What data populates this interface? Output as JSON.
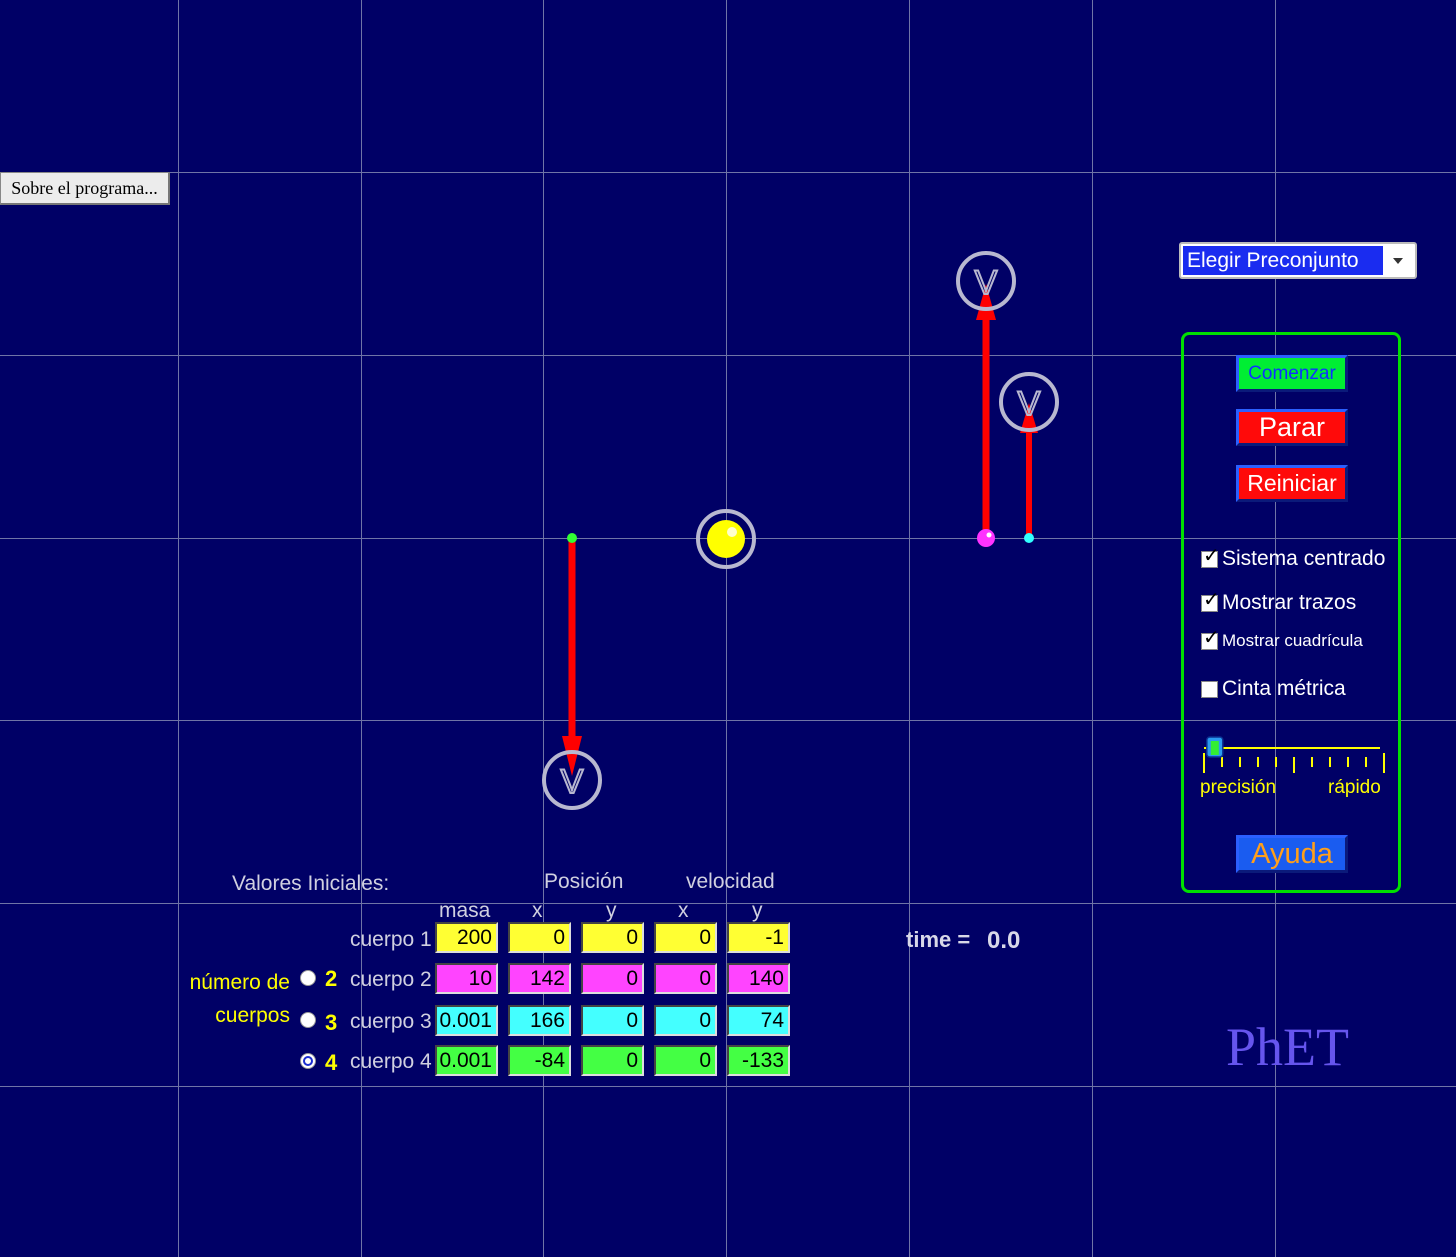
{
  "about_button": {
    "label": "Sobre el programa..."
  },
  "preset": {
    "selected": "Elegir Preconjunto"
  },
  "controls": {
    "start": "Comenzar",
    "stop": "Parar",
    "reset": "Reiniciar",
    "help": "Ayuda",
    "checkboxes": [
      {
        "label": "Sistema centrado",
        "checked": true
      },
      {
        "label": "Mostrar trazos",
        "checked": true
      },
      {
        "label": "Mostrar cuadrícula",
        "checked": true
      },
      {
        "label": "Cinta métrica",
        "checked": false
      }
    ],
    "slider": {
      "left_label": "precisión",
      "right_label": "rápido",
      "value_fraction": 0.06
    }
  },
  "time": {
    "label": "time =",
    "value": "0.0"
  },
  "logo": "PhET",
  "table": {
    "title": "Valores Iniciales:",
    "position_header": "Posición",
    "velocity_header": "velocidad",
    "col_mass": "masa",
    "col_x": "x",
    "col_y": "y",
    "rows": [
      {
        "label": "cuerpo 1",
        "mass": "200",
        "x": "0",
        "y": "0",
        "vx": "0",
        "vy": "-1"
      },
      {
        "label": "cuerpo 2",
        "mass": "10",
        "x": "142",
        "y": "0",
        "vx": "0",
        "vy": "140"
      },
      {
        "label": "cuerpo 3",
        "mass": "0.001",
        "x": "166",
        "y": "0",
        "vx": "0",
        "vy": "74"
      },
      {
        "label": "cuerpo 4",
        "mass": "0.001",
        "x": "-84",
        "y": "0",
        "vx": "0",
        "vy": "-133"
      }
    ]
  },
  "body_count": {
    "label": "número de cuerpos",
    "options": [
      "2",
      "3",
      "4"
    ],
    "selected": "4"
  },
  "colors": {
    "background": "#000066",
    "grid": "#6f74a6",
    "body1": "#ffff00",
    "body2": "#ff33ff",
    "body3": "#33ffff",
    "body4": "#33ff33",
    "velocity_arrow": "#ff0000",
    "panel_border": "#00e000"
  },
  "velocity_handle_glyph": "V"
}
